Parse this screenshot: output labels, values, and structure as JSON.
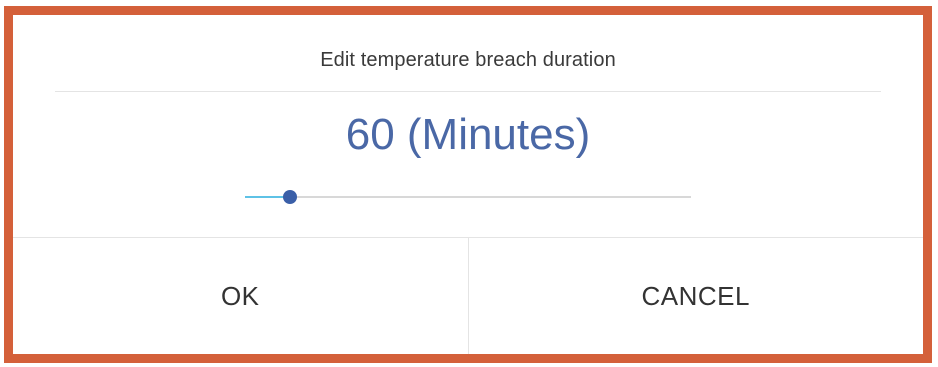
{
  "dialog": {
    "title": "Edit temperature breach duration",
    "value_text": "60 (Minutes)",
    "slider": {
      "value": 60,
      "fraction": 0.1
    },
    "ok_label": "OK",
    "cancel_label": "CANCEL"
  },
  "colors": {
    "frame_border": "#d4603a",
    "value_text": "#4a68a6",
    "slider_fill": "#5ec2e6",
    "slider_thumb": "#3a5fa8"
  }
}
